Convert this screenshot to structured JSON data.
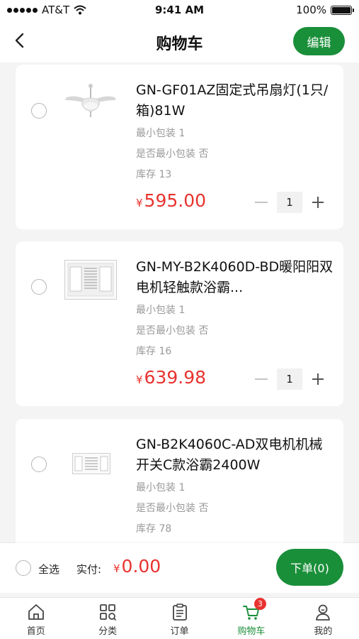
{
  "status_bar": {
    "carrier": "AT&T",
    "time": "9:41 AM",
    "battery": "100%"
  },
  "header": {
    "title": "购物车",
    "edit_label": "编辑"
  },
  "cart_items": [
    {
      "title": "GN-GF01AZ固定式吊扇灯(1只/箱)81W",
      "min_pack": "最小包装 1",
      "is_min_pack": "是否最小包装 否",
      "stock": "库存 13",
      "currency": "¥",
      "price": "595.00",
      "quantity": "1",
      "selected": false
    },
    {
      "title": "GN-MY-B2K4060D-BD暖阳阳双电机轻触款浴霸...",
      "min_pack": "最小包装 1",
      "is_min_pack": "是否最小包装 否",
      "stock": "库存 16",
      "currency": "¥",
      "price": "639.98",
      "quantity": "1",
      "selected": false
    },
    {
      "title": "GN-B2K4060C-AD双电机机械开关C款浴霸2400W",
      "min_pack": "最小包装 1",
      "is_min_pack": "是否最小包装 否",
      "stock": "库存 78",
      "selected": false
    }
  ],
  "checkout": {
    "select_all_label": "全选",
    "pay_label": "实付:",
    "currency": "¥",
    "total": "0.00",
    "order_button_label": "下单(0)"
  },
  "tab_bar": {
    "active": "cart",
    "cart_badge": "3",
    "tabs": [
      {
        "id": "home",
        "label": "首页",
        "icon": "home-icon"
      },
      {
        "id": "category",
        "label": "分类",
        "icon": "category-icon"
      },
      {
        "id": "orders",
        "label": "订单",
        "icon": "orders-icon"
      },
      {
        "id": "cart",
        "label": "购物车",
        "icon": "cart-icon"
      },
      {
        "id": "mine",
        "label": "我的",
        "icon": "profile-icon"
      }
    ]
  },
  "colors": {
    "accent": "#1a8f3a",
    "price": "#e8332f",
    "background": "#f4f4f4"
  }
}
